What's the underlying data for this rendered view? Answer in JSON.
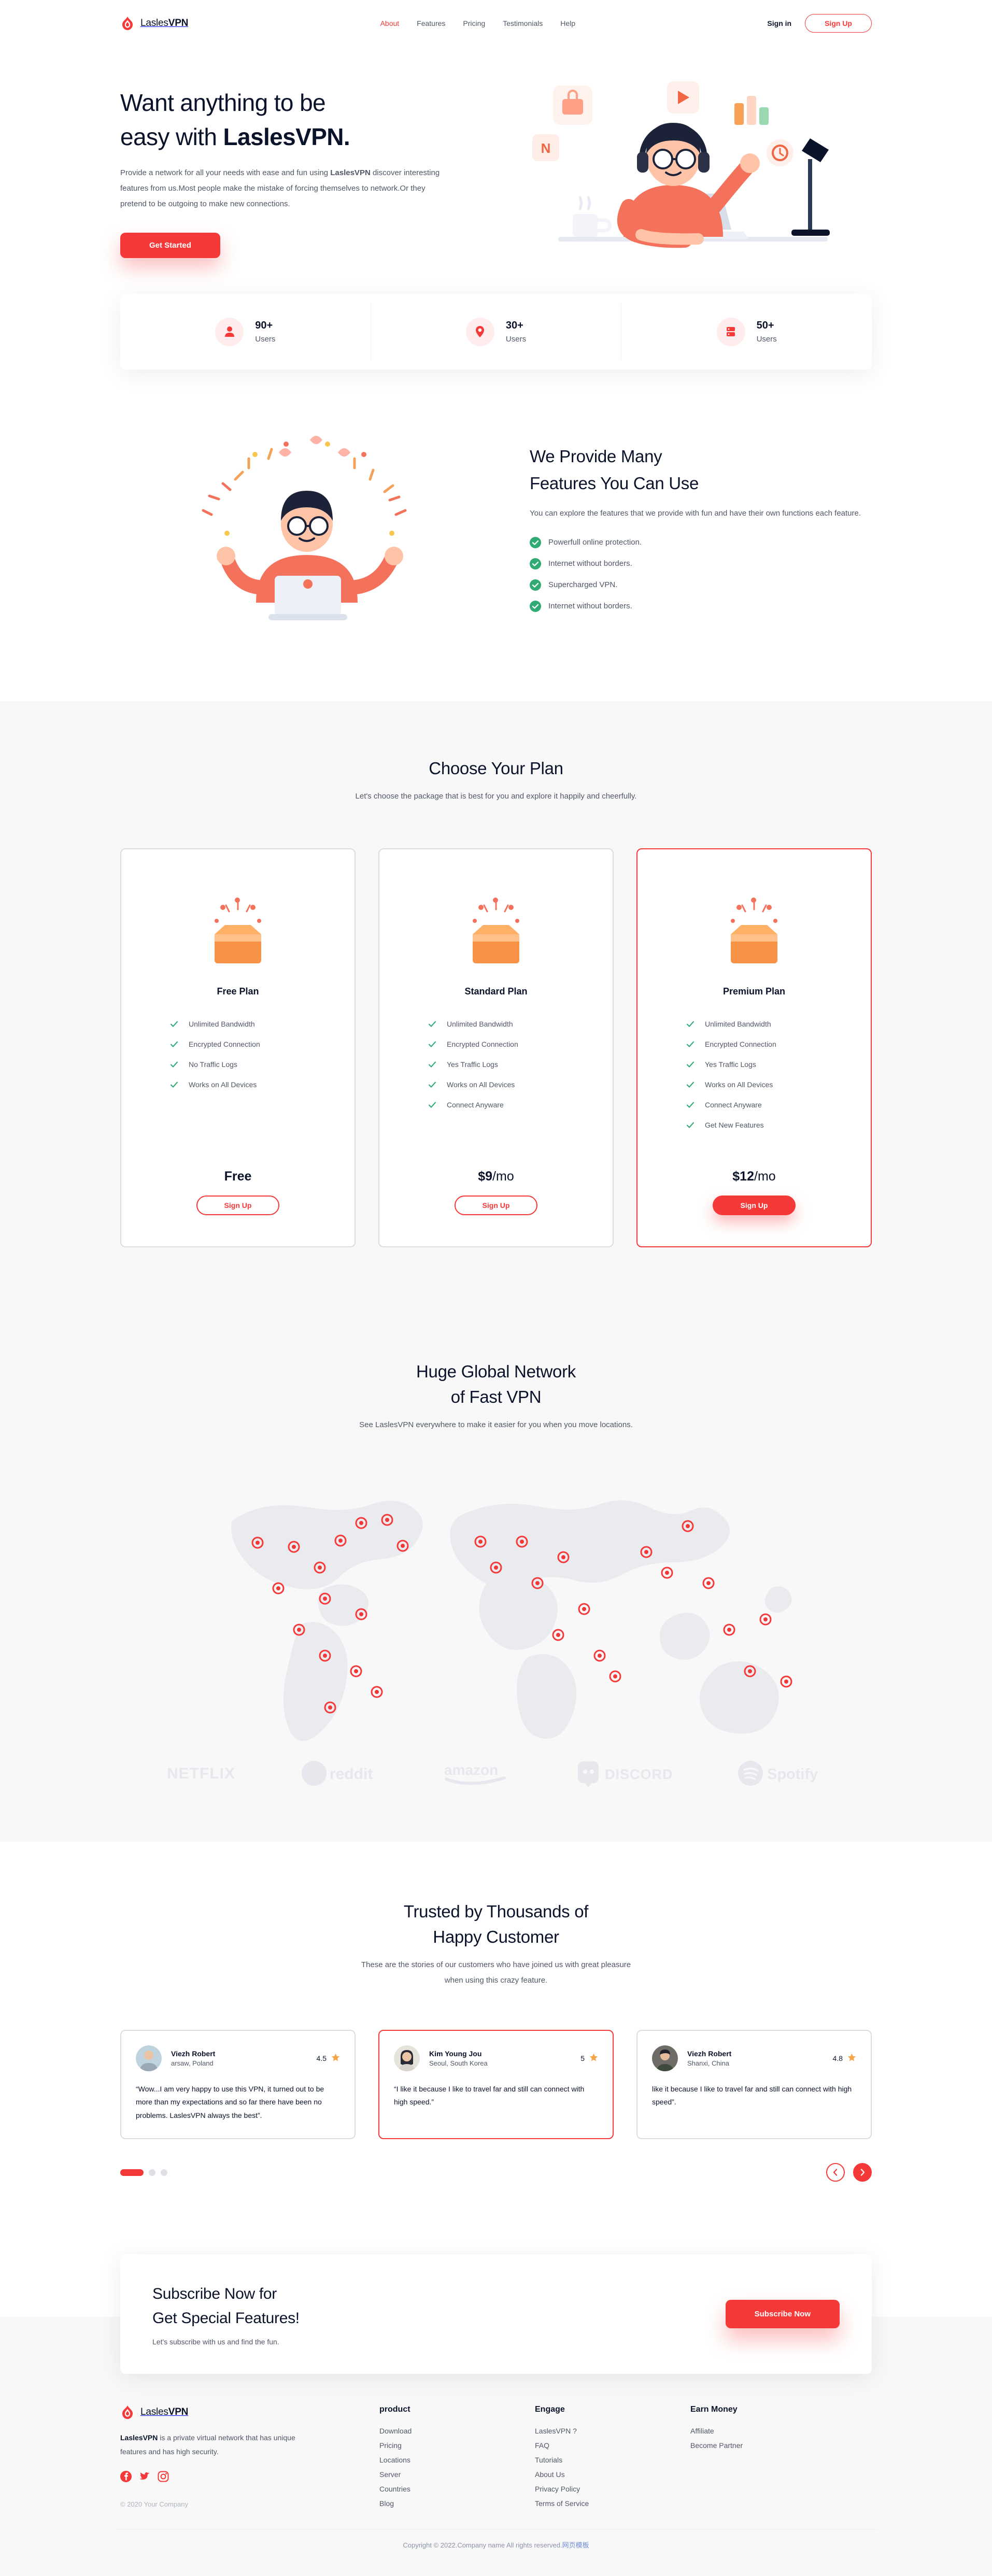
{
  "theme": {
    "accent": "#F53838",
    "dark": "#0B132A",
    "muted": "#4F5665",
    "grey_bg": "#F8F8F8",
    "green": "#2FAB73"
  },
  "navbar": {
    "brand_light": "Lasles",
    "brand_bold": "VPN",
    "links": [
      {
        "label": "About",
        "active": true
      },
      {
        "label": "Features",
        "active": false
      },
      {
        "label": "Pricing",
        "active": false
      },
      {
        "label": "Testimonials",
        "active": false
      },
      {
        "label": "Help",
        "active": false
      }
    ],
    "signin_label": "Sign in",
    "signup_label": "Sign Up"
  },
  "hero": {
    "title_line1": "Want anything to be",
    "title_line2_plain": "easy with ",
    "title_line2_bold": "LaslesVPN.",
    "desc_part1": "Provide a network for all your needs with ease and fun using ",
    "desc_bold": "LaslesVPN",
    "desc_part2": " discover interesting features from us.Most people make the mistake of forcing themselves to network.Or they pretend to be outgoing to make new connections.",
    "cta_label": "Get Started"
  },
  "stats": [
    {
      "icon": "user-icon",
      "number": "90+",
      "label": "Users"
    },
    {
      "icon": "location-pin-icon",
      "number": "30+",
      "label": "Users"
    },
    {
      "icon": "server-icon",
      "number": "50+",
      "label": "Users"
    }
  ],
  "features": {
    "title_line1": "We Provide Many",
    "title_line2": "Features You Can Use",
    "desc": "You can explore the features that we provide with fun and have their own functions each feature.",
    "items": [
      "Powerfull online protection.",
      "Internet without borders.",
      "Supercharged VPN.",
      "Internet without borders."
    ]
  },
  "pricing": {
    "title": "Choose Your Plan",
    "desc": "Let's choose the package that is best for you and explore it happily and cheerfully.",
    "plans": [
      {
        "name": "Free Plan",
        "features": [
          "Unlimited Bandwidth",
          "Encrypted Connection",
          "No Traffic Logs",
          "Works on All Devices"
        ],
        "price_main": "Free",
        "price_suffix": "",
        "button": "Sign Up",
        "featured": false
      },
      {
        "name": "Standard Plan",
        "features": [
          "Unlimited Bandwidth",
          "Encrypted Connection",
          "Yes Traffic Logs",
          "Works on All Devices",
          "Connect Anyware"
        ],
        "price_main": "$9",
        "price_suffix": "/mo",
        "button": "Sign Up",
        "featured": false
      },
      {
        "name": "Premium Plan",
        "features": [
          "Unlimited Bandwidth",
          "Encrypted Connection",
          "Yes Traffic Logs",
          "Works on All Devices",
          "Connect Anyware",
          "Get New Features"
        ],
        "price_main": "$12",
        "price_suffix": "/mo",
        "button": "Sign Up",
        "featured": true
      }
    ]
  },
  "network": {
    "title_line1": "Huge Global Network",
    "title_line2": "of Fast VPN",
    "desc": "See LaslesVPN everywhere to make it easier for you when you move locations.",
    "brands": [
      "NETFLIX",
      "reddit",
      "amazon",
      "DISCORD",
      "Spotify"
    ]
  },
  "testimonials": {
    "title_line1": "Trusted by Thousands of",
    "title_line2": "Happy Customer",
    "desc_line1": "These are the stories of our customers who have joined us with great pleasure",
    "desc_line2": "when using this crazy feature.",
    "cards": [
      {
        "name": "Viezh Robert",
        "location": "arsaw, Poland",
        "rating": "4.5",
        "text": "“Wow...I am very happy to use this VPN, it turned out to be more than my expectations and so far there have been no problems. LaslesVPN always the best”.",
        "active": false
      },
      {
        "name": "Kim Young Jou",
        "location": "Seoul, South Korea",
        "rating": "5",
        "text": "“I like it because I like to travel far and still can connect with high speed.”",
        "active": true
      },
      {
        "name": "Viezh Robert",
        "location": "Shanxi, China",
        "rating": "4.8",
        "text": "like it because I like to travel far and still can connect with high speed”.",
        "active": false
      }
    ]
  },
  "subscribe": {
    "title_line1": "Subscribe Now for",
    "title_line2": "Get Special Features!",
    "desc": "Let's subscribe with us and find the fun.",
    "button": "Subscribe Now"
  },
  "footer": {
    "brand_light": "Lasles",
    "brand_bold": "VPN",
    "desc_bold": "LaslesVPN",
    "desc_rest": " is a private virtual network that has unique features and has high security.",
    "social": [
      "facebook-icon",
      "twitter-icon",
      "instagram-icon"
    ],
    "copyright": "© 2020 Your Company",
    "columns": [
      {
        "head": "product",
        "links": [
          "Download",
          "Pricing",
          "Locations",
          "Server",
          "Countries",
          "Blog"
        ]
      },
      {
        "head": "Engage",
        "links": [
          "LaslesVPN ?",
          "FAQ",
          "Tutorials",
          "About Us",
          "Privacy Policy",
          "Terms of Service"
        ]
      },
      {
        "head": "Earn Money",
        "links": [
          "Affiliate",
          "Become Partner"
        ]
      }
    ],
    "bottom_text": "Copyright © 2022.Company name All rights reserved.",
    "bottom_link": "网页模板"
  }
}
